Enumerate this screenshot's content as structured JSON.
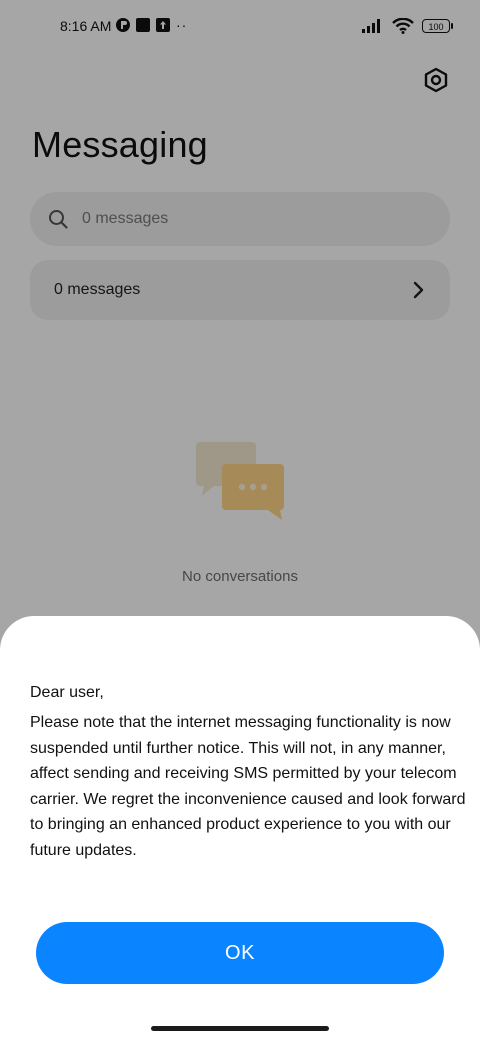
{
  "status_bar": {
    "time": "8:16 AM",
    "battery": "100",
    "dots": "··"
  },
  "header": {
    "title": "Messaging",
    "settings_icon": "settings-hexagon-icon"
  },
  "search": {
    "placeholder": "0 messages",
    "value": ""
  },
  "inbox_row": {
    "label": "0 messages",
    "icon": "chevron-right-icon"
  },
  "empty_state": {
    "icon": "chat-bubbles-icon",
    "text": "No conversations"
  },
  "dialog": {
    "greeting": "Dear user,",
    "message": "Please note that the internet messaging functionality is now suspended until further notice. This will not, in any manner, affect sending and receiving SMS permitted by your telecom carrier. We regret the inconvenience caused and look forward to bringing an enhanced product experience to you with our future updates.",
    "ok_label": "OK"
  },
  "colors": {
    "accent": "#0b84ff",
    "overlay": "rgba(0,0,0,0.35)"
  }
}
